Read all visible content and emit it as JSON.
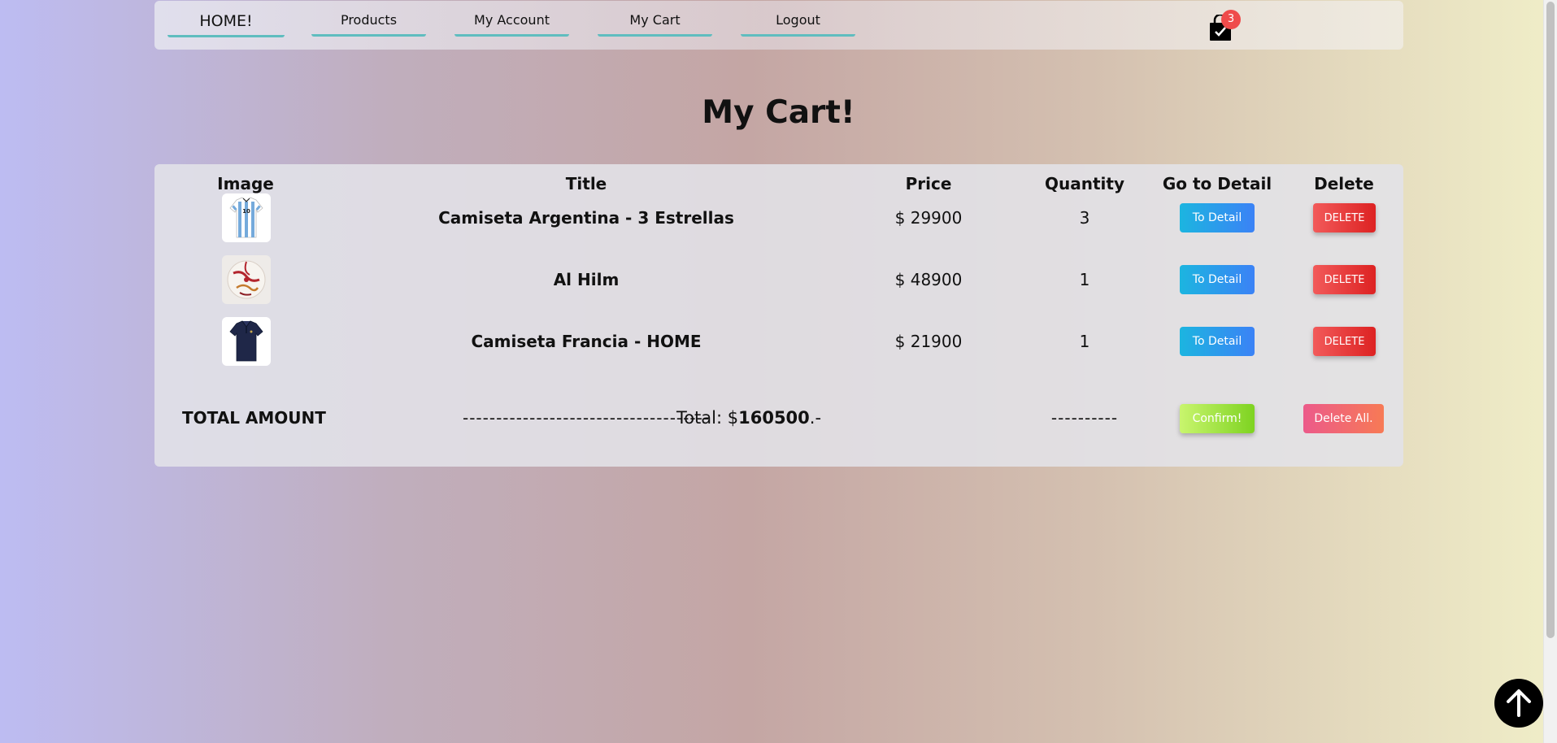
{
  "nav": {
    "items": [
      {
        "label": "HOME!"
      },
      {
        "label": "Products"
      },
      {
        "label": "My Account"
      },
      {
        "label": "My Cart"
      },
      {
        "label": "Logout"
      }
    ],
    "cart_count": "3",
    "cart_icon": "shopping-bag-check-icon"
  },
  "page": {
    "title": "My Cart!"
  },
  "table": {
    "headers": [
      "Image",
      "Title",
      "Price",
      "Quantity",
      "Go to Detail",
      "Delete"
    ],
    "rows": [
      {
        "image": "argentina-shirt",
        "title": "Camiseta Argentina - 3 Estrellas",
        "price": "$ 29900",
        "quantity": "3",
        "detail_label": "To Detail",
        "delete_label": "DELETE"
      },
      {
        "image": "al-hilm-ball",
        "title": "Al Hilm",
        "price": "$ 48900",
        "quantity": "1",
        "detail_label": "To Detail",
        "delete_label": "DELETE"
      },
      {
        "image": "france-shirt",
        "title": "Camiseta Francia - HOME",
        "price": "$ 21900",
        "quantity": "1",
        "detail_label": "To Detail",
        "delete_label": "DELETE"
      }
    ]
  },
  "summary": {
    "label": "TOTAL AMOUNT",
    "title_dashes": "-------------------------------------",
    "total_prefix": "Total: $",
    "total_value": "160500",
    "total_suffix": ".-",
    "quantity_dashes": "----------",
    "confirm_label": "Confirm!",
    "delete_all_label": "Delete All."
  },
  "colors": {
    "nav_underline": "#5fbdbf",
    "badge": "#ef4b4b",
    "detail_button": "#3b82f6",
    "delete_button": "#dd2222",
    "confirm_button": "#7ed321",
    "delete_all_button": "#ec5a8a"
  },
  "scroll_top_icon": "arrow-up-icon"
}
